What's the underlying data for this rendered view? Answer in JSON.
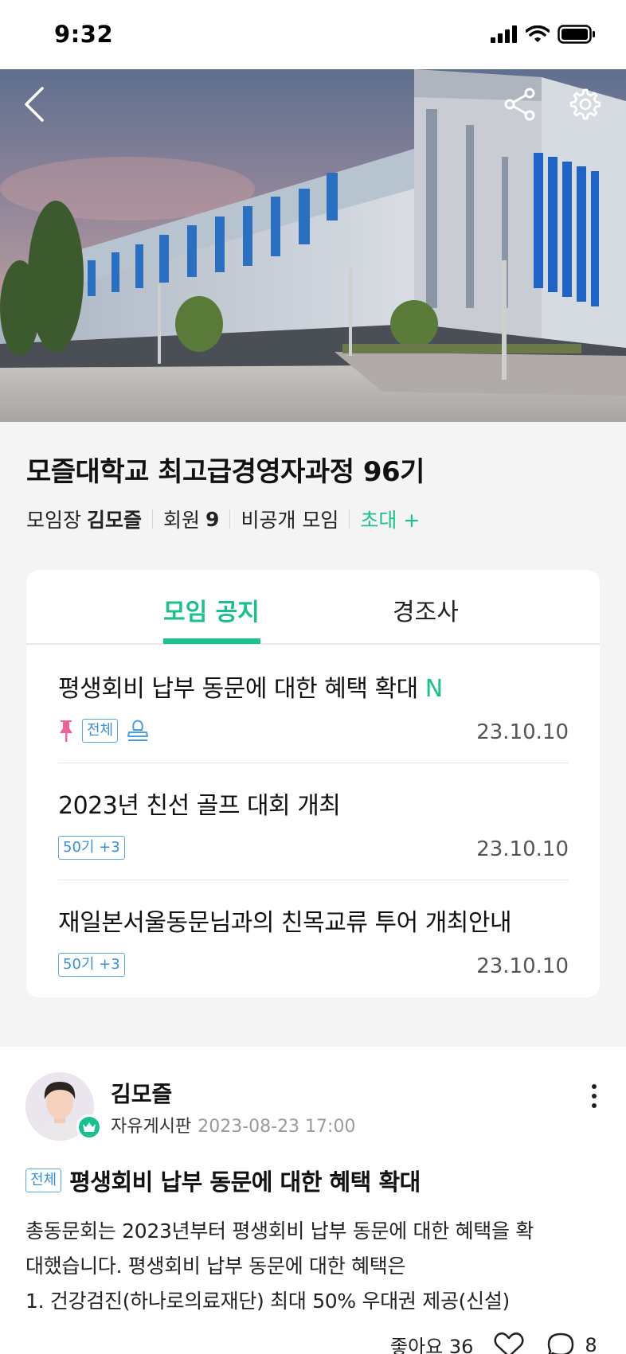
{
  "status_bar": {
    "time": "9:32"
  },
  "hero": {
    "back_icon": "chevron-left-icon",
    "share_icon": "share-icon",
    "settings_icon": "gear-icon"
  },
  "group": {
    "title": "모즐대학교 최고급경영자과정 96기",
    "leader_label": "모임장",
    "leader_name": "김모즐",
    "member_label": "회원",
    "member_count": "9",
    "privacy": "비공개 모임",
    "invite_label": "초대 +"
  },
  "tabs": [
    {
      "label": "모임 공지",
      "active": true
    },
    {
      "label": "경조사",
      "active": false
    }
  ],
  "notices": [
    {
      "title": "평생회비 납부 동문에 대한 혜택 확대",
      "new": "N",
      "pinned": true,
      "tag": "전체",
      "has_stamp_icon": true,
      "date": "23.10.10"
    },
    {
      "title": "2023년 친선 골프 대회 개최",
      "tag": "50기 +3",
      "date": "23.10.10"
    },
    {
      "title": "재일본서울동문님과의 친목교류 투어 개최안내",
      "tag": "50기 +3",
      "date": "23.10.10"
    }
  ],
  "post": {
    "author": "김모즐",
    "board": "자유게시판",
    "timestamp": "2023-08-23 17:00",
    "tag": "전체",
    "title": "평생회비 납부 동문에 대한 혜택 확대",
    "body_lines": [
      "총동문회는 2023년부터 평생회비 납부 동문에 대한 혜택을 확",
      "대했습니다. 평생회비 납부 동문에 대한 혜택은",
      "1. 건강검진(하나로의료재단) 최대 50% 우대권 제공(신설)"
    ],
    "like_label": "좋아요 36",
    "comment_count": "8"
  },
  "colors": {
    "accent": "#1cbf8e",
    "tag_blue": "#3a8fd4",
    "pin_pink": "#f0609a"
  }
}
